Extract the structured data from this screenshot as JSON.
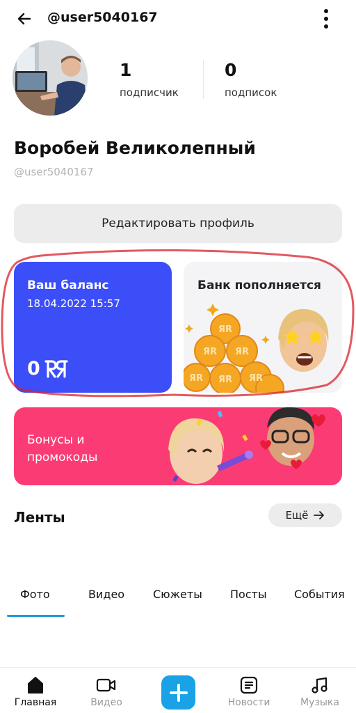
{
  "header": {
    "handle": "@user5040167"
  },
  "profile": {
    "name": "Воробей Великолепный",
    "handle": "@user5040167",
    "stats": [
      {
        "value": "1",
        "label": "подписчик"
      },
      {
        "value": "0",
        "label": "подписок"
      }
    ],
    "edit_label": "Редактировать профиль"
  },
  "cards": {
    "balance": {
      "title": "Ваш баланс",
      "date": "18.04.2022 15:57",
      "amount": "0",
      "currency_icon": "coin-logo-icon"
    },
    "bank": {
      "title": "Банк пополняется"
    },
    "bonus": {
      "title": "Бонусы и промокоды"
    }
  },
  "feeds": {
    "title": "Ленты",
    "more_label": "Ещё"
  },
  "tabs": [
    {
      "label": "Фото",
      "active": true
    },
    {
      "label": "Видео",
      "active": false
    },
    {
      "label": "Сюжеты",
      "active": false
    },
    {
      "label": "Посты",
      "active": false
    },
    {
      "label": "События",
      "active": false
    }
  ],
  "bottom_nav": [
    {
      "label": "Главная",
      "icon": "home-icon",
      "active": true
    },
    {
      "label": "Видео",
      "icon": "video-camera-icon",
      "active": false
    },
    {
      "label": "",
      "icon": "plus-icon",
      "active": false
    },
    {
      "label": "Новости",
      "icon": "news-icon",
      "active": false
    },
    {
      "label": "Музыка",
      "icon": "music-note-icon",
      "active": false
    }
  ],
  "colors": {
    "balance_bg": "#3b4ef8",
    "bonus_bg": "#fb3c74",
    "accent": "#19a2e6",
    "annotation": "#d9222a"
  }
}
